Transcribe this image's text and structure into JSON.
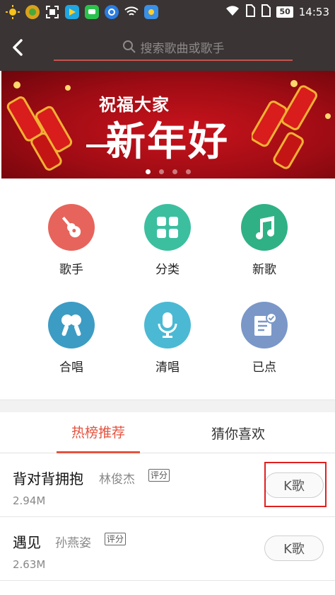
{
  "status_bar": {
    "battery": "50",
    "time": "14:53",
    "icons": [
      "sun-icon",
      "game-icon",
      "scan-icon",
      "play-icon",
      "chat-icon",
      "browser-icon",
      "wifi-icon",
      "weather-icon"
    ]
  },
  "header": {
    "search_placeholder": "搜索歌曲或歌手"
  },
  "banner": {
    "title_small": "祝福大家",
    "title_big": "新年好",
    "page_count": 4,
    "active_page": 0
  },
  "categories": [
    {
      "label": "歌手",
      "color": "#e7645c"
    },
    {
      "label": "分类",
      "color": "#3cbf9f"
    },
    {
      "label": "新歌",
      "color": "#2fb185"
    },
    {
      "label": "合唱",
      "color": "#3c9cc4"
    },
    {
      "label": "清唱",
      "color": "#4bb9d3"
    },
    {
      "label": "已点",
      "color": "#7a97c8"
    }
  ],
  "tabs": {
    "hot": "热榜推荐",
    "guess": "猜你喜欢"
  },
  "songs": [
    {
      "title": "背对背拥抱",
      "artist": "林俊杰",
      "badge": "评分",
      "size": "2.94M",
      "action": "K歌"
    },
    {
      "title": "遇见",
      "artist": "孙燕姿",
      "badge": "评分",
      "size": "2.63M",
      "action": "K歌"
    }
  ],
  "colors": {
    "accent": "#e5533f",
    "header_bg": "#3a3434",
    "banner_red": "#c8131c"
  }
}
